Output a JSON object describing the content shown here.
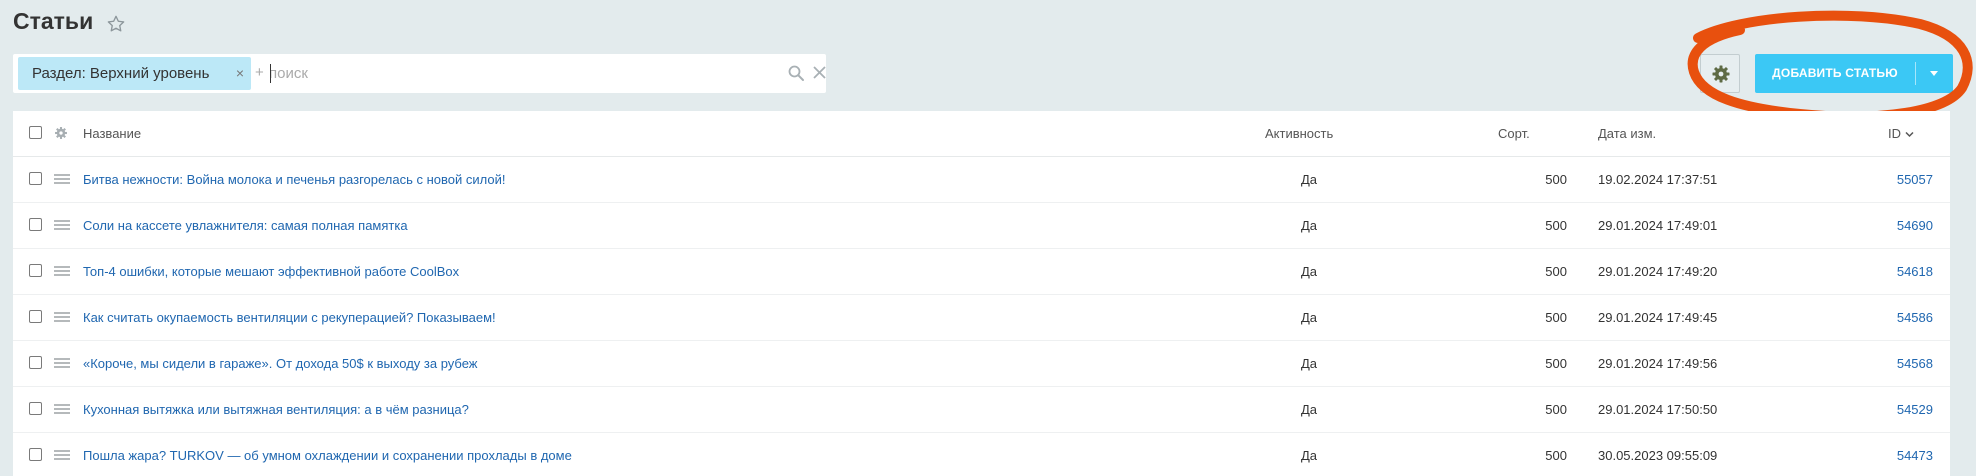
{
  "page": {
    "title": "Статьи"
  },
  "filter": {
    "tag_label": "Раздел: Верхний уровень",
    "tag_close": "×",
    "plus": "+",
    "search_placeholder": "поиск"
  },
  "toolbar": {
    "add_label": "ДОБАВИТЬ СТАТЬЮ"
  },
  "icons": {
    "star": "star-icon",
    "search": "search-icon",
    "clear": "close-icon",
    "settings": "gear-icon",
    "drag": "drag-handle-icon",
    "sort": "chevron-down-icon"
  },
  "colors": {
    "accent": "#3bc8f5",
    "link": "#2067b0",
    "filter_tag": "#bce8f7",
    "annotation": "#e8500e"
  },
  "table": {
    "headers": {
      "name": "Название",
      "active": "Активность",
      "sort": "Сорт.",
      "date": "Дата изм.",
      "id": "ID"
    },
    "rows": [
      {
        "name": "Битва нежности: Война молока и печенья разгорелась с новой силой!",
        "active": "Да",
        "sort": "500",
        "date": "19.02.2024 17:37:51",
        "id": "55057"
      },
      {
        "name": "Соли на кассете увлажнителя: самая полная памятка",
        "active": "Да",
        "sort": "500",
        "date": "29.01.2024 17:49:01",
        "id": "54690"
      },
      {
        "name": "Топ-4 ошибки, которые мешают эффективной работе CoolBox",
        "active": "Да",
        "sort": "500",
        "date": "29.01.2024 17:49:20",
        "id": "54618"
      },
      {
        "name": "Как считать окупаемость вентиляции с рекуперацией? Показываем!",
        "active": "Да",
        "sort": "500",
        "date": "29.01.2024 17:49:45",
        "id": "54586"
      },
      {
        "name": "«Короче, мы сидели в гараже». От дохода 50$ к выходу за рубеж",
        "active": "Да",
        "sort": "500",
        "date": "29.01.2024 17:49:56",
        "id": "54568"
      },
      {
        "name": "Кухонная вытяжка или вытяжная вентиляция: а в чём разница?",
        "active": "Да",
        "sort": "500",
        "date": "29.01.2024 17:50:50",
        "id": "54529"
      },
      {
        "name": "Пошла жара? TURKOV — об умном охлаждении и сохранении прохлады в доме",
        "active": "Да",
        "sort": "500",
        "date": "30.05.2023 09:55:09",
        "id": "54473"
      }
    ]
  }
}
